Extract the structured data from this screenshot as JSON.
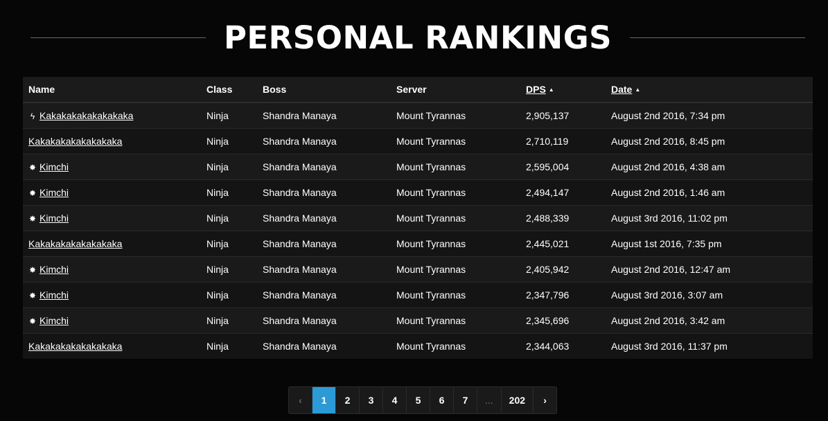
{
  "title": "PERSONAL RANKINGS",
  "table": {
    "headers": {
      "name": "Name",
      "class": "Class",
      "boss": "Boss",
      "server": "Server",
      "dps": "DPS",
      "date": "Date"
    },
    "sort_glyph": "▲",
    "rows": [
      {
        "icon": "lightning-bolt-icon",
        "icon_glyph": "ϟ",
        "name": "Kakakakakakakakaka",
        "class": "Ninja",
        "boss": "Shandra Manaya",
        "server": "Mount Tyrannas",
        "dps": "2,905,137",
        "date": "August 2nd 2016, 7:34 pm"
      },
      {
        "icon": "",
        "icon_glyph": "",
        "name": "Kakakakakakakakaka",
        "class": "Ninja",
        "boss": "Shandra Manaya",
        "server": "Mount Tyrannas",
        "dps": "2,710,119",
        "date": "August 2nd 2016, 8:45 pm"
      },
      {
        "icon": "burst-star-icon",
        "icon_glyph": "✸",
        "name": "Kimchi",
        "class": "Ninja",
        "boss": "Shandra Manaya",
        "server": "Mount Tyrannas",
        "dps": "2,595,004",
        "date": "August 2nd 2016, 4:38 am"
      },
      {
        "icon": "burst-star-icon",
        "icon_glyph": "✸",
        "name": "Kimchi",
        "class": "Ninja",
        "boss": "Shandra Manaya",
        "server": "Mount Tyrannas",
        "dps": "2,494,147",
        "date": "August 2nd 2016, 1:46 am"
      },
      {
        "icon": "burst-star-icon",
        "icon_glyph": "✸",
        "name": "Kimchi",
        "class": "Ninja",
        "boss": "Shandra Manaya",
        "server": "Mount Tyrannas",
        "dps": "2,488,339",
        "date": "August 3rd 2016, 11:02 pm"
      },
      {
        "icon": "",
        "icon_glyph": "",
        "name": "Kakakakakakakakaka",
        "class": "Ninja",
        "boss": "Shandra Manaya",
        "server": "Mount Tyrannas",
        "dps": "2,445,021",
        "date": "August 1st 2016, 7:35 pm"
      },
      {
        "icon": "burst-star-icon",
        "icon_glyph": "✸",
        "name": "Kimchi",
        "class": "Ninja",
        "boss": "Shandra Manaya",
        "server": "Mount Tyrannas",
        "dps": "2,405,942",
        "date": "August 2nd 2016, 12:47 am"
      },
      {
        "icon": "burst-star-icon",
        "icon_glyph": "✸",
        "name": "Kimchi",
        "class": "Ninja",
        "boss": "Shandra Manaya",
        "server": "Mount Tyrannas",
        "dps": "2,347,796",
        "date": "August 3rd 2016, 3:07 am"
      },
      {
        "icon": "burst-star-icon",
        "icon_glyph": "✸",
        "name": "Kimchi",
        "class": "Ninja",
        "boss": "Shandra Manaya",
        "server": "Mount Tyrannas",
        "dps": "2,345,696",
        "date": "August 2nd 2016, 3:42 am"
      },
      {
        "icon": "",
        "icon_glyph": "",
        "name": "Kakakakakakakakaka",
        "class": "Ninja",
        "boss": "Shandra Manaya",
        "server": "Mount Tyrannas",
        "dps": "2,344,063",
        "date": "August 3rd 2016, 11:37 pm"
      }
    ]
  },
  "pagination": {
    "prev": "‹",
    "pages": [
      "1",
      "2",
      "3",
      "4",
      "5",
      "6",
      "7"
    ],
    "ellipsis": "...",
    "last": "202",
    "next": "›",
    "current": "1"
  },
  "colors": {
    "background": "#060606",
    "active_page": "#2c9ad6"
  }
}
